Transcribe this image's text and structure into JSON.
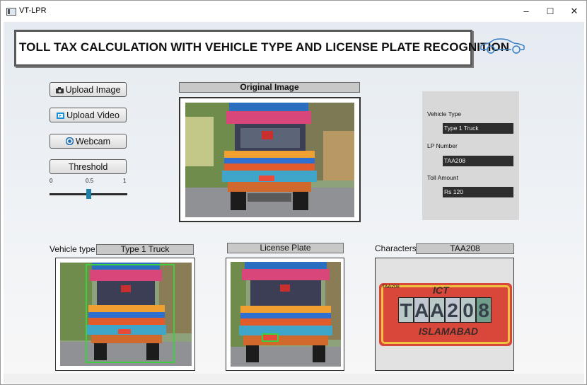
{
  "window": {
    "title": "VT-LPR",
    "minimize_glyph": "–",
    "maximize_glyph": "☐",
    "close_glyph": "✕"
  },
  "header": {
    "title": "TOLL TAX CALCULATION WITH VEHICLE TYPE AND LICENSE PLATE RECOGNITION",
    "logo_icon": "car-outline-icon"
  },
  "controls": {
    "upload_image": "Upload Image",
    "upload_video": "Upload Video",
    "webcam": "Webcam",
    "threshold": "Threshold",
    "slider": {
      "min_label": "0",
      "mid_label": "0.5",
      "max_label": "1",
      "value": 0.5
    }
  },
  "original_image": {
    "title": "Original Image"
  },
  "results": {
    "vehicle_type_label": "Vehicle Type",
    "vehicle_type_value": "Type 1 Truck",
    "lp_number_label": "LP Number",
    "lp_number_value": "TAA208",
    "toll_amount_label": "Toll Amount",
    "toll_amount_value": "Rs 120"
  },
  "bottom": {
    "vehicle_type_label": "Vehicle type:",
    "vehicle_type_value": "Type 1 Truck",
    "license_plate_title": "License Plate",
    "characters_label": "Characters",
    "characters_value": "TAA208"
  },
  "plate": {
    "top_text": "ICT",
    "small_text": "TAA208",
    "chars": [
      "T",
      "A",
      "A",
      "2",
      "0",
      "8"
    ],
    "bottom_text": "ISLAMABAD"
  },
  "colors": {
    "detection_box": "#3ecf3e",
    "slider_handle": "#1f7fa8",
    "logo": "#3a7fc4"
  }
}
